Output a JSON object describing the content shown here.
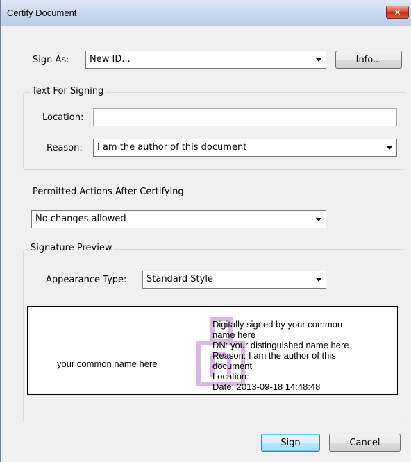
{
  "window": {
    "title": "Certify Document",
    "close_glyph": "✕"
  },
  "sign_as": {
    "label": "Sign As:",
    "value": "New ID...",
    "info_button": "Info..."
  },
  "text_for_signing": {
    "group_title": "Text For Signing",
    "location_label": "Location:",
    "location_value": "",
    "reason_label": "Reason:",
    "reason_value": "I am the author of this document"
  },
  "permitted": {
    "label": "Permitted Actions After Certifying",
    "value": "No changes allowed"
  },
  "signature_preview": {
    "group_title": "Signature Preview",
    "appearance_label": "Appearance Type:",
    "appearance_value": "Standard Style",
    "common_name": "your common name here",
    "details": [
      "Digitally signed by your common",
      "name here",
      "DN: your distinguished name here",
      "Reason: I am the author of this",
      "document",
      "Location:",
      "Date: 2013-09-18 14:48:48"
    ]
  },
  "buttons": {
    "sign": "Sign",
    "cancel": "Cancel"
  },
  "colors": {
    "watermark": "#d9b8e6",
    "close": "#c8311a"
  }
}
